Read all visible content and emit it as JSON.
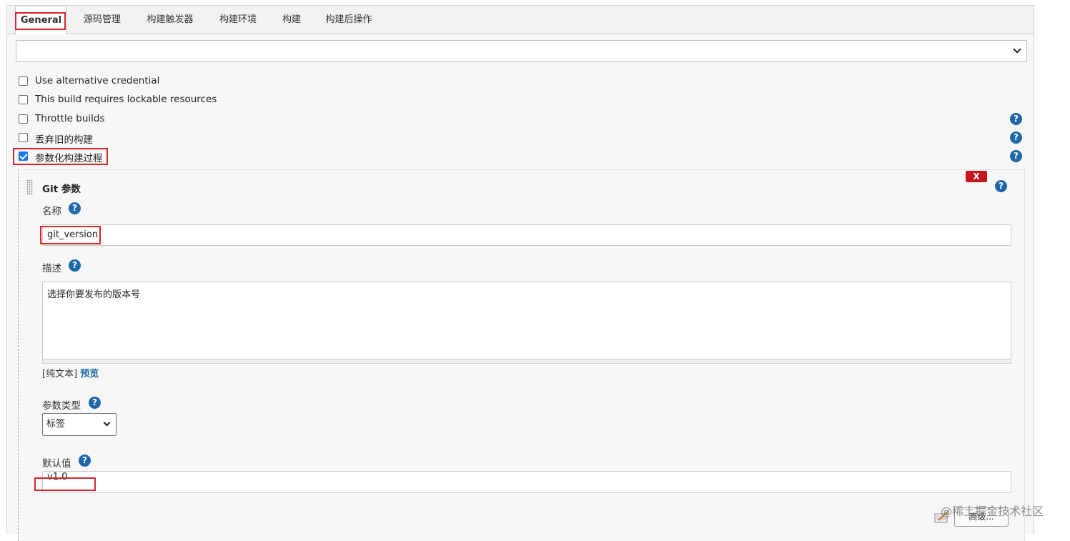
{
  "tabs": [
    {
      "label": "General",
      "active": true
    },
    {
      "label": "源码管理"
    },
    {
      "label": "构建触发器"
    },
    {
      "label": "构建环境"
    },
    {
      "label": "构建"
    },
    {
      "label": "构建后操作"
    }
  ],
  "top_select": {
    "value": ""
  },
  "options": [
    {
      "label": "Use alternative credential",
      "checked": false
    },
    {
      "label": "This build requires lockable resources",
      "checked": false
    },
    {
      "label": "Throttle builds",
      "checked": false
    },
    {
      "label": "丢弃旧的构建",
      "checked": false
    },
    {
      "label": "参数化构建过程",
      "checked": true
    }
  ],
  "parameter": {
    "title": "Git 参数",
    "delete_label": "X",
    "name_label": "名称",
    "name_value": "git_version",
    "description_label": "描述",
    "description_value": "选择你要发布的版本号",
    "format_prefix": "[纯文本]",
    "preview_link": "预览",
    "type_label": "参数类型",
    "type_value": "标签",
    "default_label": "默认值",
    "default_value": "v1.0",
    "advanced_button": "高级..."
  },
  "watermark": "@稀土掘金技术社区",
  "colors": {
    "highlight": "#d9242b",
    "help": "#1f67a8",
    "delete": "#c4161c"
  }
}
